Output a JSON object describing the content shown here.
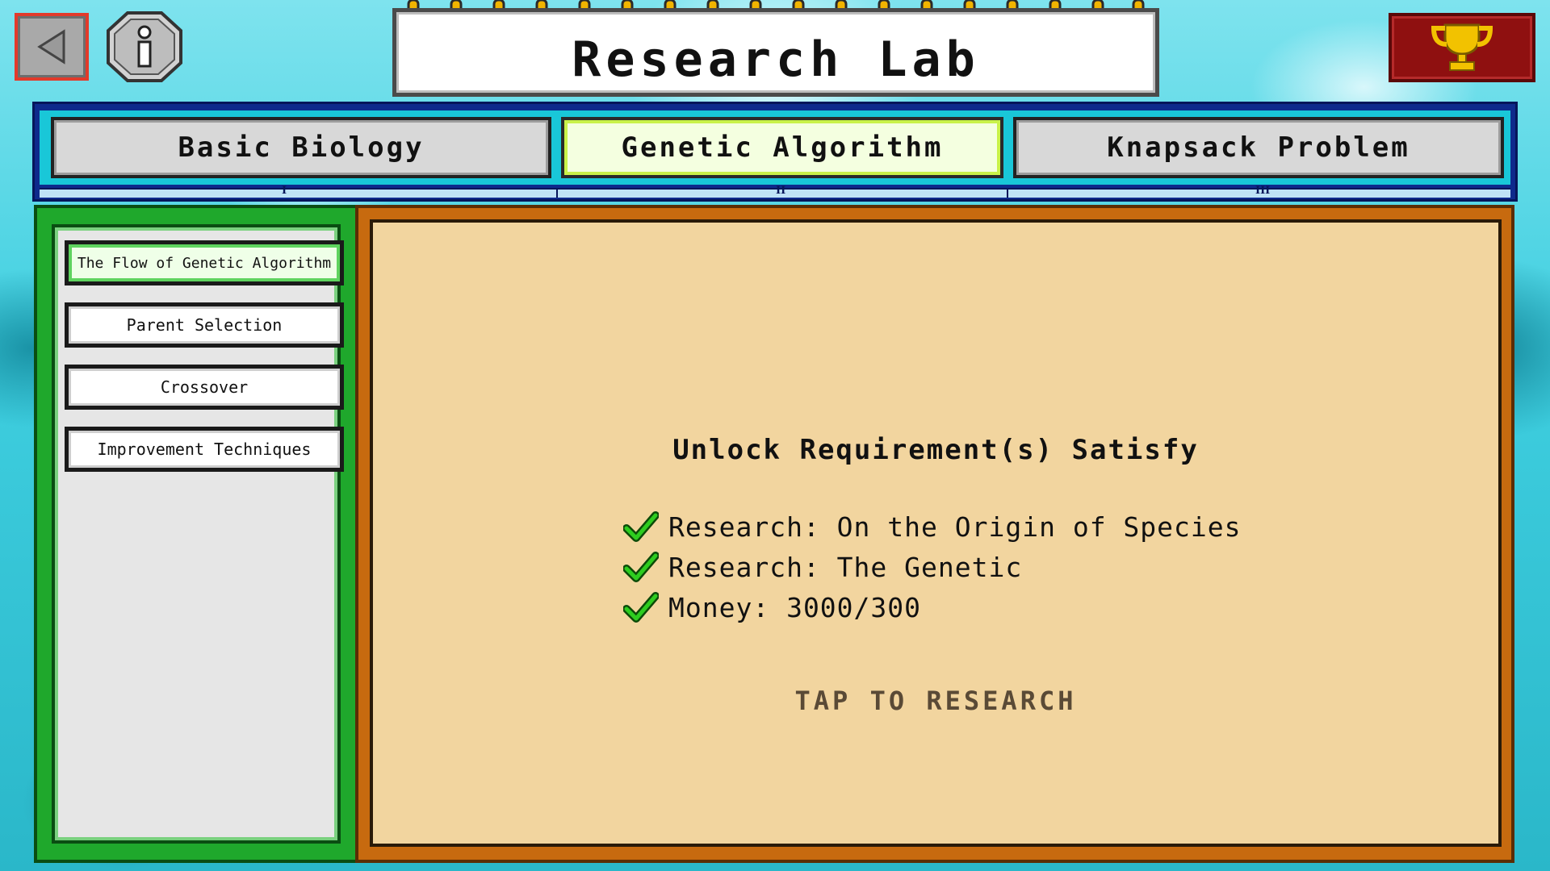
{
  "header": {
    "title": "Research Lab",
    "back_icon": "back-arrow-icon",
    "info_icon": "info-icon",
    "trophy_icon": "trophy-icon"
  },
  "tabs": [
    {
      "label": "Basic Biology",
      "numeral": "I",
      "active": false
    },
    {
      "label": "Genetic Algorithm",
      "numeral": "II",
      "active": true
    },
    {
      "label": "Knapsack Problem",
      "numeral": "III",
      "active": false
    }
  ],
  "sidebar": {
    "items": [
      {
        "label": "The Flow of Genetic Algorithm",
        "active": true
      },
      {
        "label": "Parent Selection",
        "active": false
      },
      {
        "label": "Crossover",
        "active": false
      },
      {
        "label": "Improvement Techniques",
        "active": false
      }
    ]
  },
  "main": {
    "requirement_title": "Unlock Requirement(s) Satisfy",
    "requirements": [
      {
        "text": "Research: On the Origin of Species",
        "met": true
      },
      {
        "text": "Research: The Genetic",
        "met": true
      },
      {
        "text": "Money: 3000/300",
        "met": true
      }
    ],
    "tap_label": "TAP TO RESEARCH"
  },
  "colors": {
    "active_tab": "#f4ffe0",
    "sidebar_green": "#1fa82c",
    "panel_orange": "#c76a0f",
    "panel_paper": "#f2d59f",
    "trophy_red": "#8f1010",
    "check_green": "#2ecc1f"
  }
}
